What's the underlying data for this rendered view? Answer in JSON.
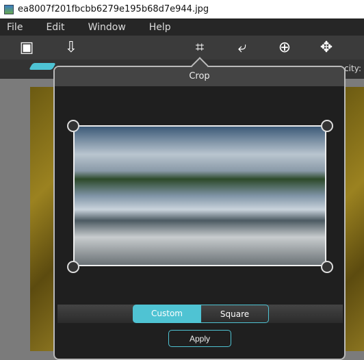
{
  "window": {
    "title": "ea8007f201fbcbb6279e195b68d7e944.jpg"
  },
  "menu": [
    "File",
    "Edit",
    "Window",
    "Help"
  ],
  "toolbar": {
    "icons": [
      "image-icon",
      "save-icon",
      "crop-icon",
      "rotate-icon",
      "zoom-in-icon",
      "move-icon"
    ]
  },
  "subbar": {
    "opacity_label": "city:"
  },
  "crop_panel": {
    "title": "Crop",
    "modes": [
      "Custom",
      "Square"
    ],
    "selected_mode": "Custom",
    "apply_label": "Apply"
  },
  "colors": {
    "accent": "#4fc3d3"
  }
}
